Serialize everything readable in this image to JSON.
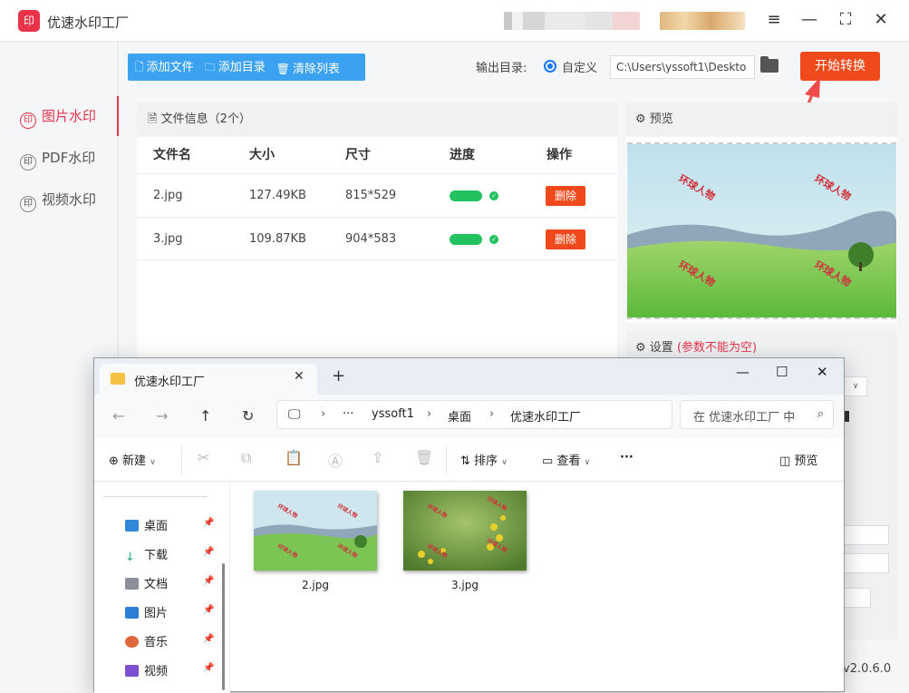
{
  "app": {
    "title": "优速水印工厂",
    "logo_text": "印",
    "version": "v2.0.6.0"
  },
  "window_controls": {
    "menu": "≡",
    "minimize": "—",
    "maximize": "⛶",
    "close": "✕"
  },
  "sidebar": {
    "items": [
      {
        "label": "图片水印",
        "icon": "watermark-icon",
        "active": true
      },
      {
        "label": "PDF水印",
        "icon": "watermark-icon",
        "active": false
      },
      {
        "label": "视频水印",
        "icon": "watermark-icon",
        "active": false
      }
    ]
  },
  "toolbar": {
    "add_file": "添加文件",
    "add_dir": "添加目录",
    "clear_list": "清除列表"
  },
  "output": {
    "label": "输出目录:",
    "option": "自定义",
    "path": "C:\\Users\\yssoft1\\Deskto",
    "start_button": "开始转换"
  },
  "file_panel": {
    "header": "文件信息（2个）",
    "columns": [
      "文件名",
      "大小",
      "尺寸",
      "进度",
      "操作"
    ],
    "rows": [
      {
        "name": "2.jpg",
        "size": "127.49KB",
        "dims": "815*529",
        "progress": 1.0,
        "action": "删除"
      },
      {
        "name": "3.jpg",
        "size": "109.87KB",
        "dims": "904*583",
        "progress": 1.0,
        "action": "删除"
      }
    ]
  },
  "preview": {
    "header": "预览",
    "watermark_text": "环球人物"
  },
  "settings": {
    "header": "设置",
    "warning": "(参数不能为空)"
  },
  "explorer": {
    "tab_title": "优速水印工厂",
    "breadcrumb": [
      "yssoft1",
      "桌面",
      "优速水印工厂"
    ],
    "search_placeholder": "在 优速水印工厂 中",
    "commands": {
      "new": "新建",
      "sort": "排序",
      "view": "查看",
      "more": "···",
      "preview": "预览"
    },
    "nav_items": [
      {
        "label": "桌面",
        "color": "#2f88d8"
      },
      {
        "label": "下载",
        "color": "#1fa87a"
      },
      {
        "label": "文档",
        "color": "#8a8f99"
      },
      {
        "label": "图片",
        "color": "#2a7fd4"
      },
      {
        "label": "音乐",
        "color": "#e0673a"
      },
      {
        "label": "视频",
        "color": "#7b4fcf"
      }
    ],
    "files": [
      {
        "name": "2.jpg"
      },
      {
        "name": "3.jpg"
      }
    ]
  },
  "colors": {
    "accent": "#e8334a",
    "primary_blue": "#3aa2f0",
    "start_orange": "#f04a1c",
    "progress_green": "#22c25f"
  }
}
